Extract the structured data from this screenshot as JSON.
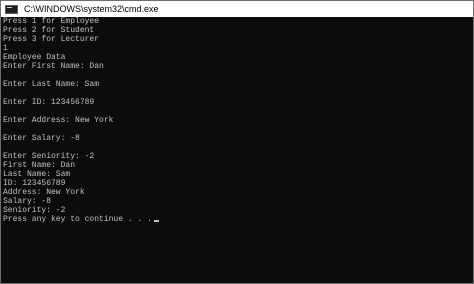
{
  "window": {
    "title": "C:\\WINDOWS\\system32\\cmd.exe",
    "icon": "cmd-icon"
  },
  "console": {
    "lines": [
      "Press 1 for Employee",
      "Press 2 for Student",
      "Press 3 for Lecturer",
      "1",
      "Employee Data",
      "Enter First Name: Dan",
      "",
      "Enter Last Name: Sam",
      "",
      "Enter ID: 123456789",
      "",
      "Enter Address: New York",
      "",
      "Enter Salary: -8",
      "",
      "Enter Seniority: -2",
      "First Name: Dan",
      "Last Name: Sam",
      "ID: 123456789",
      "Address: New York",
      "Salary: -8",
      "Seniority: -2",
      "Press any key to continue . . ."
    ]
  },
  "colors": {
    "background": "#0c0c0c",
    "text": "#c0c0c0",
    "titlebar": "#ffffff"
  }
}
